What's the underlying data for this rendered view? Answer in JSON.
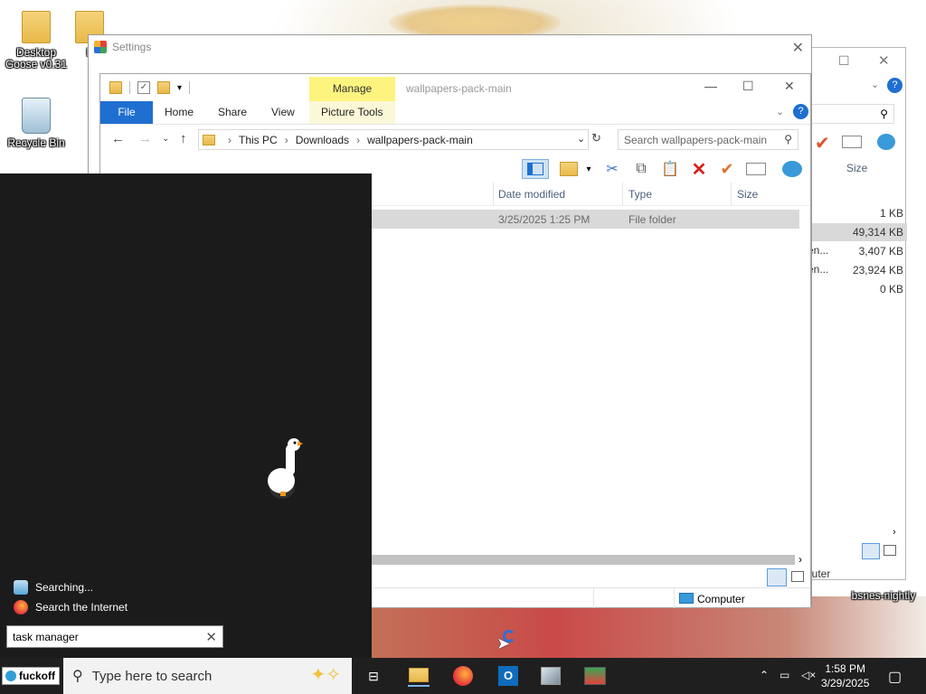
{
  "desktop": {
    "icons": [
      {
        "label": "Desktop Goose v0.31",
        "icon": "folder-icon"
      },
      {
        "label": "b",
        "icon": "folder-icon"
      },
      {
        "label": "Recycle Bin",
        "icon": "recycle-bin-icon"
      }
    ],
    "bsnes_label": "bsnes-nightly"
  },
  "settings_window": {
    "title": "Settings",
    "close": "✕"
  },
  "explorer": {
    "title": "wallpapers-pack-main",
    "manage_tab": "Manage",
    "ribbon_tabs": {
      "file": "File",
      "home": "Home",
      "share": "Share",
      "view": "View",
      "picture_tools": "Picture Tools"
    },
    "window_buttons": {
      "minimize": "—",
      "maximize": "☐",
      "close": "✕"
    },
    "breadcrumb": {
      "this_pc": "This PC",
      "downloads": "Downloads",
      "folder": "wallpapers-pack-main"
    },
    "search_placeholder": "Search wallpapers-pack-main",
    "columns": {
      "date": "Date modified",
      "type": "Type",
      "size": "Size"
    },
    "rows": [
      {
        "date": "3/25/2025 1:25 PM",
        "type": "File folder",
        "size": ""
      }
    ],
    "status_computer": "Computer"
  },
  "back_window": {
    "size_header": "Size",
    "sizes": [
      "1 KB",
      "49,314 KB",
      "3,407 KB",
      "23,924 KB",
      "0 KB"
    ],
    "type_fragments": [
      "en...",
      "en..."
    ],
    "status_computer": "puter"
  },
  "start_search": {
    "results": [
      {
        "label": "Searching...",
        "icon": "search-app-icon"
      },
      {
        "label": "Search the Internet",
        "icon": "firefox-icon"
      }
    ],
    "query": "task manager"
  },
  "taskbar": {
    "start_label": "fuckoff",
    "search_placeholder": "Type here to search",
    "time": "1:58 PM",
    "date": "3/29/2025"
  }
}
